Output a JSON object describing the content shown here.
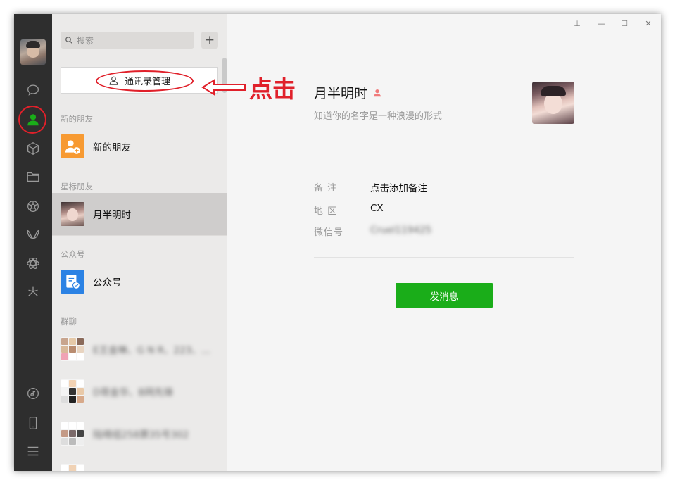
{
  "search": {
    "placeholder": "搜索"
  },
  "list": {
    "manage_label": "通讯录管理",
    "sections": {
      "new_friends": "新的朋友",
      "starred": "星标朋友",
      "official": "公众号",
      "groups": "群聊"
    },
    "items": {
      "new_friends": "新的朋友",
      "starred_friend": "月半明时",
      "official": "公众号",
      "group1": "E王金琳、G N R、223、...",
      "group2": "D哥金华、B网先锋",
      "group3": "陆晴组258票35号302"
    }
  },
  "annotation": {
    "text": "点击"
  },
  "window_controls": {
    "pin": "⊥",
    "minimize": "—",
    "maximize": "☐",
    "close": "✕"
  },
  "profile": {
    "name": "月半明时",
    "signature": "知道你的名字是一种浪漫的形式",
    "remark_label": "备  注",
    "remark_value": "点击添加备注",
    "region_label": "地  区",
    "region_value": "CX",
    "wechat_id_label": "微信号",
    "wechat_id_value": "Cruel119425",
    "send_label": "发消息"
  },
  "colors": {
    "accent_green": "#1aad19",
    "annotation_red": "#e0202a",
    "rail": "#2e2e2e"
  }
}
